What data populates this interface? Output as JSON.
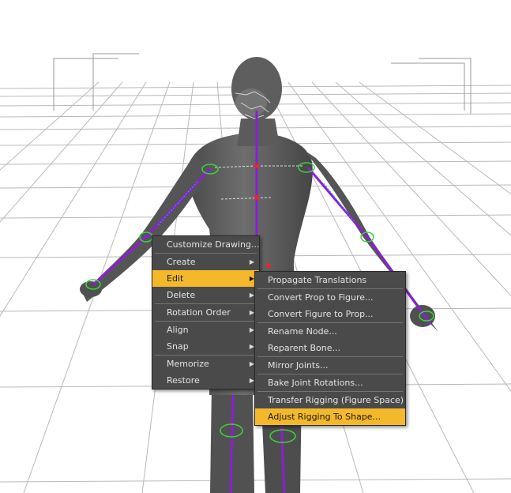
{
  "context_menu": {
    "items": [
      {
        "label": "Customize Drawing...",
        "submenu": false
      },
      {
        "label": "Create",
        "submenu": true
      },
      {
        "label": "Edit",
        "submenu": true,
        "highlighted": true
      },
      {
        "label": "Delete",
        "submenu": true
      },
      {
        "label": "Rotation Order",
        "submenu": true
      },
      {
        "label": "Align",
        "submenu": true
      },
      {
        "label": "Snap",
        "submenu": true
      },
      {
        "label": "Memorize",
        "submenu": true
      },
      {
        "label": "Restore",
        "submenu": true
      }
    ]
  },
  "edit_submenu": {
    "items": [
      {
        "label": "Propagate Translations"
      },
      {
        "label": "Convert Prop to Figure..."
      },
      {
        "label": "Convert Figure to Prop..."
      },
      {
        "label": "Rename Node..."
      },
      {
        "label": "Reparent Bone..."
      },
      {
        "label": "Mirror Joints..."
      },
      {
        "label": "Bake Joint Rotations..."
      },
      {
        "label": "Transfer Rigging (Figure Space)"
      },
      {
        "label": "Adjust Rigging To Shape...",
        "highlighted": true
      }
    ]
  },
  "colors": {
    "menu_background": "#4a4a4a",
    "highlight": "#f4b92a",
    "figure": "#5a5a5a",
    "bones": "#8a1fd4",
    "joint_rings": "#3fd13f"
  }
}
